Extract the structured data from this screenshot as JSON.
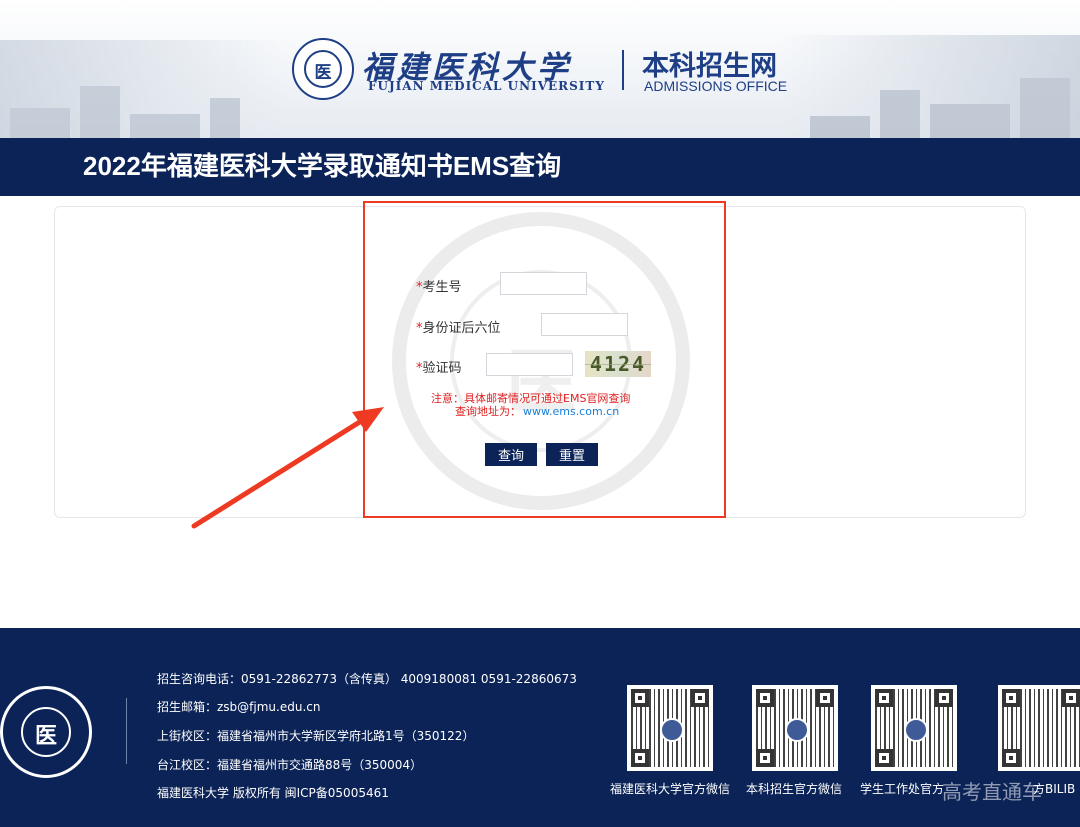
{
  "header": {
    "university_cn": "福建医科大学",
    "university_en": "FUJIAN MEDICAL UNIVERSITY",
    "office_cn": "本科招生网",
    "office_en": "ADMISSIONS OFFICE",
    "seal_glyph": "医"
  },
  "title": "2022年福建医科大学录取通知书EMS查询",
  "form": {
    "required_mark": "*",
    "exam_id_label": "考生号",
    "exam_id_value": "",
    "id_last6_label": "身份证后六位",
    "id_last6_value": "",
    "captcha_label": "验证码",
    "captcha_value": "",
    "captcha_image_text": "4124",
    "note_line1": "注意：具体邮寄情况可通过EMS官网查询",
    "note_line2_prefix": "查询地址为：",
    "note_link": "www.ems.com.cn",
    "query_button": "查询",
    "reset_button": "重置"
  },
  "footer": {
    "phone_line": "招生咨询电话：0591-22862773（含传真） 4009180081 0591-22860673",
    "email_line": "招生邮箱：zsb@fjmu.edu.cn",
    "campus1_line": "上街校区：福建省福州市大学新区学府北路1号（350122）",
    "campus2_line": "台江校区：福建省福州市交通路88号（350004）",
    "copyright_line": "福建医科大学 版权所有 闽ICP备05005461",
    "qr_captions": [
      "福建医科大学官方微信",
      "本科招生官方微信",
      "学生工作处官方",
      "方BILIB"
    ],
    "corner_watermark": "高考直通车"
  },
  "colors": {
    "navy": "#0b2357",
    "brand_blue": "#1e3f85",
    "highlight_red": "#ee3a22",
    "note_red": "#e02020",
    "link_blue": "#1a7fd6"
  },
  "icons": {
    "arrow": "annotation-arrow-icon",
    "seal": "university-seal-icon"
  }
}
